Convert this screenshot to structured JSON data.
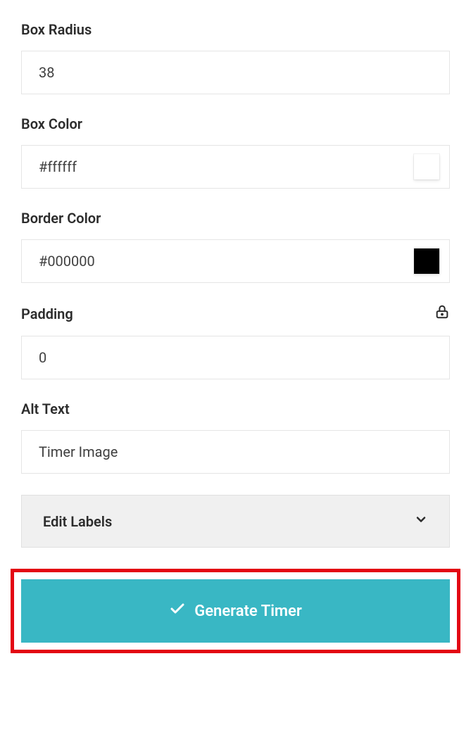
{
  "fields": {
    "box_radius": {
      "label": "Box Radius",
      "value": "38"
    },
    "box_color": {
      "label": "Box Color",
      "value": "#ffffff",
      "swatch": "#ffffff"
    },
    "border_color": {
      "label": "Border Color",
      "value": "#000000",
      "swatch": "#000000"
    },
    "padding": {
      "label": "Padding",
      "value": "0"
    },
    "alt_text": {
      "label": "Alt Text",
      "value": "Timer Image"
    }
  },
  "accordion": {
    "edit_labels": "Edit Labels"
  },
  "buttons": {
    "generate": "Generate Timer"
  },
  "colors": {
    "primary": "#39b7c4",
    "highlight_border": "#e30613"
  }
}
